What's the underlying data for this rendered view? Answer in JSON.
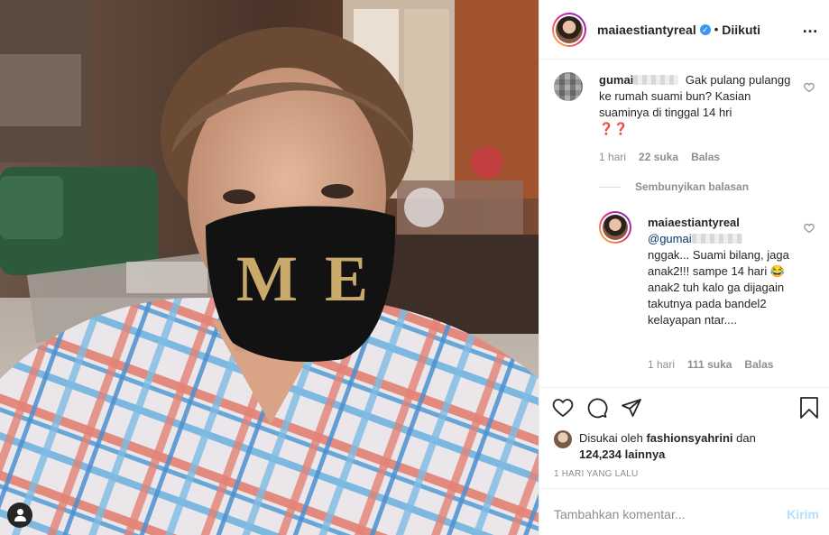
{
  "post": {
    "owner": "maiaestiantyreal",
    "follow_state": "Diikuti",
    "separator": "•",
    "more": "…"
  },
  "photo": {
    "mask_text": "M E",
    "user_tag_icon": "user-tag-icon"
  },
  "comments": [
    {
      "username": "gumai",
      "text": "Gak pulang pulangg ke rumah suami bun? Kasian suaminya di tinggal 14 hri",
      "emoji": "❓❓",
      "time": "1 hari",
      "likes": "22 suka",
      "reply": "Balas"
    }
  ],
  "hide_replies": "Sembunyikan balasan",
  "reply": {
    "username": "maiaestiantyreal",
    "mention": "@gumai",
    "line1": "nggak... Suami bilang, jaga anak2!!! sampe 14 hari",
    "emoji": "😂",
    "line2": "anak2 tuh kalo ga dijagain takutnya pada bandel2 kelayapan ntar....",
    "time": "1 hari",
    "likes": "111 suka",
    "reply": "Balas"
  },
  "likes": {
    "prefix": "Disukai oleh",
    "user": "fashionsyahrini",
    "conj": "dan",
    "count": "124,234 lainnya"
  },
  "time_ago": "1 HARI YANG LALU",
  "comment_box": {
    "placeholder": "Tambahkan komentar...",
    "post_label": "Kirim"
  },
  "colors": {
    "verified": "#3897f0",
    "meta": "#8e8e8e",
    "post_disabled": "#b2dffc"
  }
}
